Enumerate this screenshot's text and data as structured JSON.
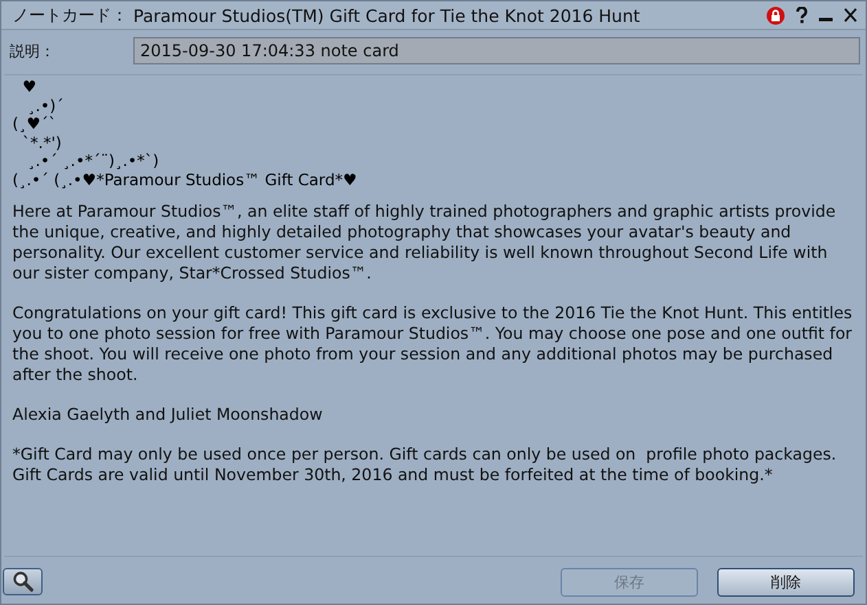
{
  "window": {
    "title_label": "ノートカード：",
    "title": "Paramour Studios(TM) Gift Card for Tie the Knot 2016 Hunt",
    "locked": true
  },
  "description": {
    "label": "説明：",
    "value": "2015-09-30 17:04:33 note card"
  },
  "notecard": {
    "art": [
      "  ♥",
      "   ¸.•)´",
      "(¸♥´`",
      "  `*.*')",
      "   ¸.•´ ¸.•*´¨)¸.•*`)",
      "(¸.•´ (¸.•♥*Paramour Studios™ Gift Card*♥"
    ],
    "paragraphs": [
      "Here at Paramour Studios™, an elite staff of highly trained photographers and graphic artists provide the unique, creative, and highly detailed photography that showcases your avatar's beauty and personality. Our excellent customer service and reliability is well known throughout Second Life with our sister company, Star*Crossed Studios™.",
      "Congratulations on your gift card! This gift card is exclusive to the 2016 Tie the Knot Hunt. This entitles you to one photo session for free with Paramour Studios™. You may choose one pose and one outfit for the shoot. You will receive one photo from your session and any additional photos may be purchased after the shoot.",
      "Alexia Gaelyth and Juliet Moonshadow",
      "*Gift Card may only be used once per person. Gift cards can only be used on  profile photo packages. Gift Cards are valid until November 30th, 2016 and must be forfeited at the time of booking.*"
    ]
  },
  "buttons": [
    {
      "label": "保存",
      "disabled": true
    },
    {
      "label": "削除",
      "disabled": false
    }
  ]
}
